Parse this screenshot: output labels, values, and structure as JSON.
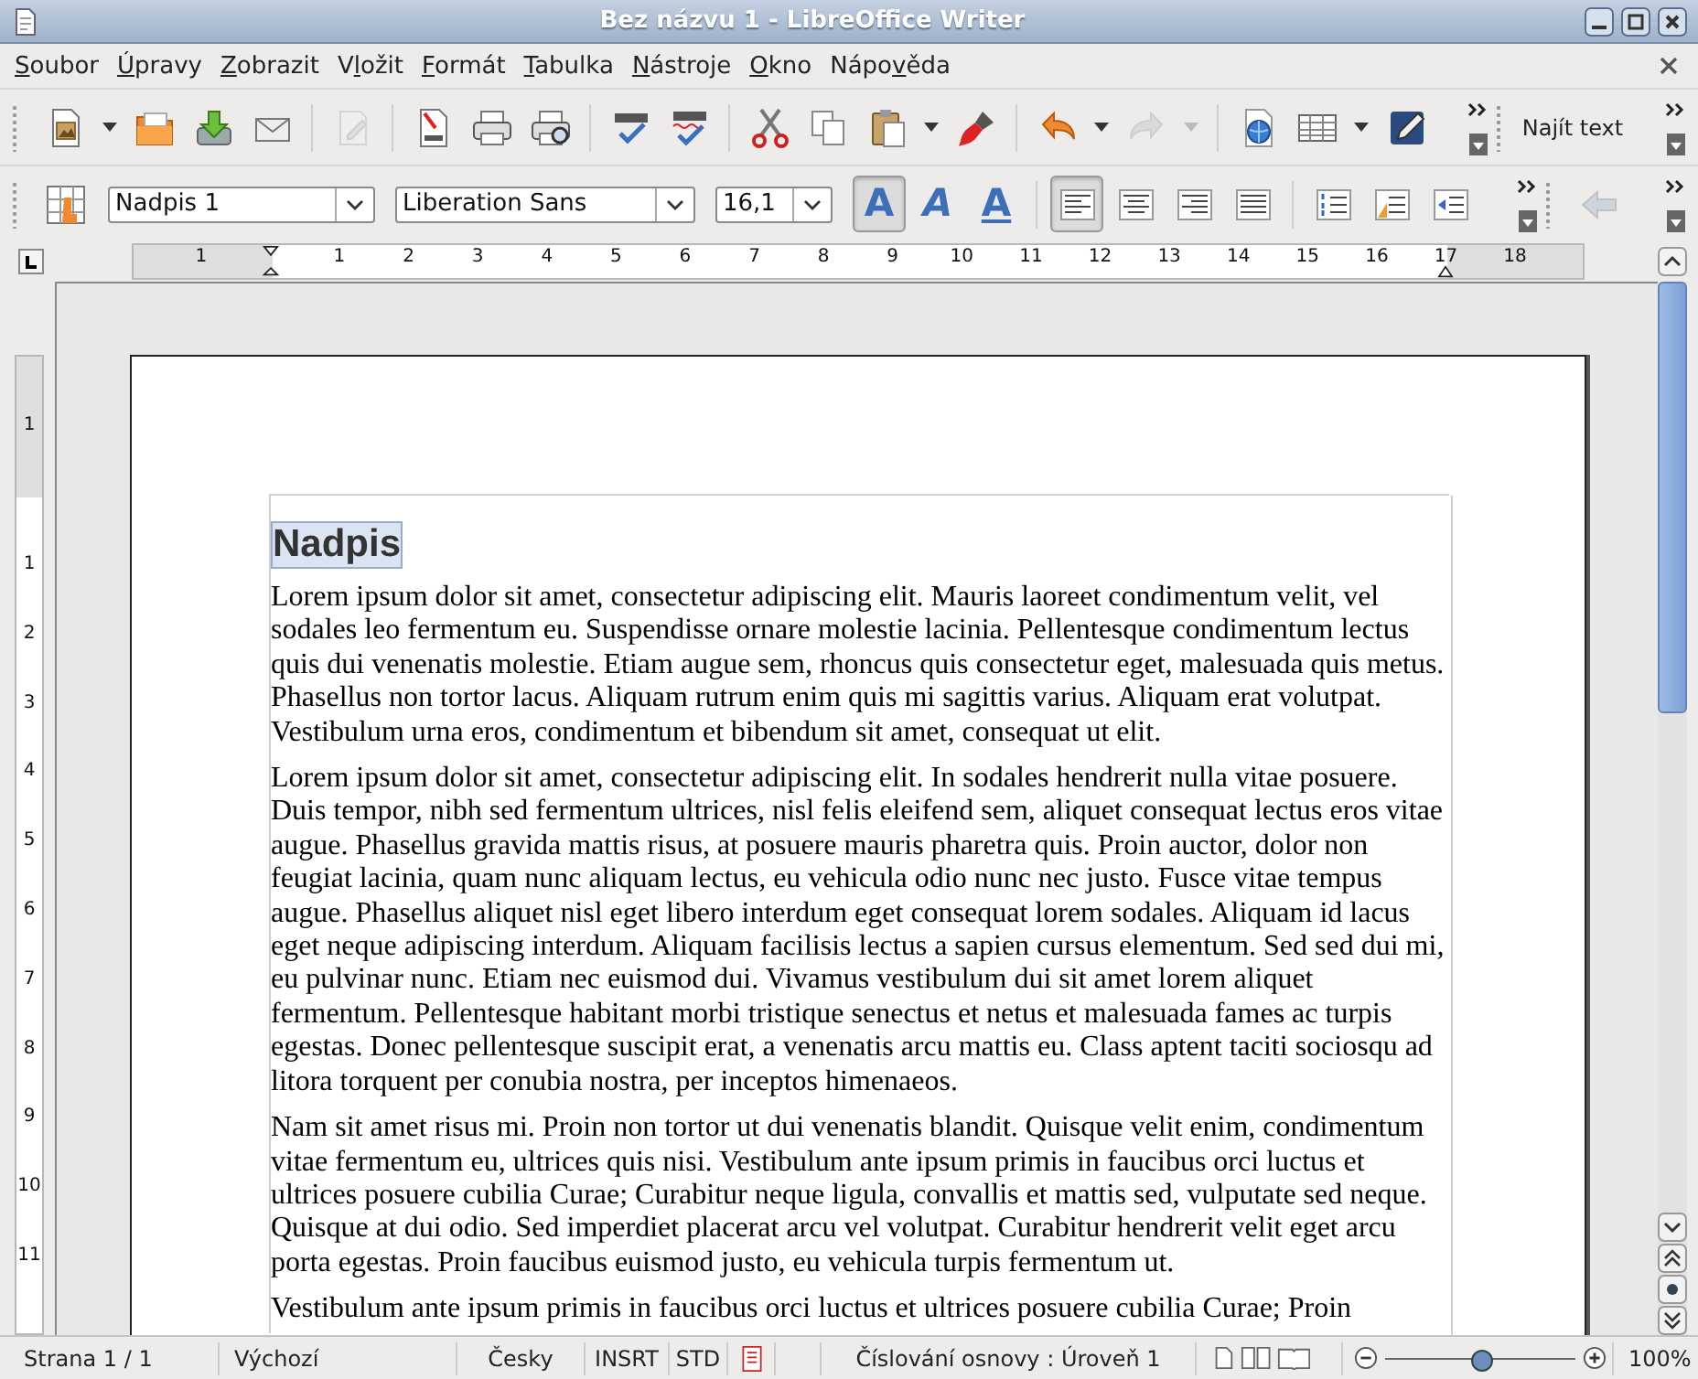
{
  "window": {
    "title": "Bez názvu 1 - LibreOffice Writer"
  },
  "menu": [
    {
      "label": "Soubor"
    },
    {
      "label": "Úpravy"
    },
    {
      "label": "Zobrazit"
    },
    {
      "label": "Vložit"
    },
    {
      "label": "Formát"
    },
    {
      "label": "Tabulka"
    },
    {
      "label": "Nástroje"
    },
    {
      "label": "Okno"
    },
    {
      "label": "Nápověda"
    }
  ],
  "standard_toolbar": {
    "groups": [
      [
        {
          "kind": "new",
          "dropdown": true,
          "disabled": false
        },
        {
          "kind": "open",
          "dropdown": false,
          "disabled": false
        },
        {
          "kind": "save",
          "dropdown": false,
          "disabled": false
        },
        {
          "kind": "mail",
          "dropdown": false,
          "disabled": false
        }
      ],
      [
        {
          "kind": "edit",
          "dropdown": false,
          "disabled": true
        }
      ],
      [
        {
          "kind": "pdf",
          "dropdown": false,
          "disabled": false
        },
        {
          "kind": "print",
          "dropdown": false,
          "disabled": false
        },
        {
          "kind": "preview",
          "dropdown": false,
          "disabled": false
        }
      ],
      [
        {
          "kind": "spell",
          "dropdown": false,
          "disabled": false
        },
        {
          "kind": "autospell",
          "dropdown": false,
          "disabled": false
        }
      ],
      [
        {
          "kind": "cut",
          "dropdown": false,
          "disabled": false
        },
        {
          "kind": "copy",
          "dropdown": false,
          "disabled": false
        },
        {
          "kind": "paste",
          "dropdown": true,
          "disabled": false
        },
        {
          "kind": "brush",
          "dropdown": false,
          "disabled": false
        }
      ],
      [
        {
          "kind": "undo",
          "dropdown": true,
          "disabled": false
        },
        {
          "kind": "redo",
          "dropdown": true,
          "disabled": true
        }
      ],
      [
        {
          "kind": "navigator",
          "dropdown": false,
          "disabled": false
        },
        {
          "kind": "table",
          "dropdown": true,
          "disabled": false
        },
        {
          "kind": "draw",
          "dropdown": false,
          "disabled": false
        }
      ]
    ],
    "find_label": "Najít text"
  },
  "formatting_toolbar": {
    "paragraph_style": "Nadpis 1",
    "font_name": "Liberation Sans",
    "font_size": "16,1",
    "char_buttons": [
      {
        "kind": "bold",
        "label": "A",
        "selected": true
      },
      {
        "kind": "italic",
        "label": "A",
        "selected": false
      },
      {
        "kind": "underline",
        "label": "A",
        "selected": false
      }
    ],
    "align_buttons": [
      {
        "kind": "left",
        "selected": true
      },
      {
        "kind": "center",
        "selected": false
      },
      {
        "kind": "right",
        "selected": false
      },
      {
        "kind": "justify",
        "selected": false
      }
    ],
    "list_buttons": [
      {
        "kind": "numbering"
      },
      {
        "kind": "bullets"
      },
      {
        "kind": "outdent"
      }
    ],
    "back_button": {
      "disabled": true
    }
  },
  "horizontal_ruler": {
    "labels": [
      "1",
      "1",
      "2",
      "3",
      "4",
      "5",
      "6",
      "7",
      "8",
      "9",
      "10",
      "11",
      "12",
      "13",
      "14",
      "15",
      "16",
      "17",
      "18"
    ]
  },
  "vertical_ruler": {
    "labels": [
      "1",
      "1",
      "2",
      "3",
      "4",
      "5",
      "6",
      "7",
      "8",
      "9",
      "10",
      "11"
    ]
  },
  "document": {
    "heading": {
      "text": "Nadpis",
      "selected": true
    },
    "paragraphs": [
      "Lorem ipsum dolor sit amet, consectetur adipiscing elit. Mauris laoreet condimentum velit, vel sodales leo fermentum eu. Suspendisse ornare molestie lacinia. Pellentesque condimentum lectus quis dui venenatis molestie. Etiam augue sem, rhoncus quis consectetur eget, malesuada quis metus. Phasellus non tortor lacus. Aliquam rutrum enim quis mi sagittis varius. Aliquam erat volutpat. Vestibulum urna eros, condimentum et bibendum sit amet, consequat ut elit.",
      "Lorem ipsum dolor sit amet, consectetur adipiscing elit. In sodales hendrerit nulla vitae posuere. Duis tempor, nibh sed fermentum ultrices, nisl felis eleifend sem, aliquet consequat lectus eros vitae augue. Phasellus gravida mattis risus, at posuere mauris pharetra quis. Proin auctor, dolor non feugiat lacinia, quam nunc aliquam lectus, eu vehicula odio nunc nec justo. Fusce vitae tempus augue. Phasellus aliquet nisl eget libero interdum eget consequat lorem sodales. Aliquam id lacus eget neque adipiscing interdum. Aliquam facilisis lectus a sapien cursus elementum. Sed sed dui mi, eu pulvinar nunc. Etiam nec euismod dui. Vivamus vestibulum dui sit amet lorem aliquet fermentum. Pellentesque habitant morbi tristique senectus et netus et malesuada fames ac turpis egestas. Donec pellentesque suscipit erat, a venenatis arcu mattis eu. Class aptent taciti sociosqu ad litora torquent per conubia nostra, per inceptos himenaeos.",
      "Nam sit amet risus mi. Proin non tortor ut dui venenatis blandit. Quisque velit enim, condimentum vitae fermentum eu, ultrices quis nisi. Vestibulum ante ipsum primis in faucibus orci luctus et ultrices posuere cubilia Curae; Curabitur neque ligula, convallis et mattis sed, vulputate sed neque. Quisque at dui odio. Sed imperdiet placerat arcu vel volutpat. Curabitur hendrerit velit eget arcu porta egestas. Proin faucibus euismod justo, eu vehicula turpis fermentum ut.",
      "Vestibulum ante ipsum primis in faucibus orci luctus et ultrices posuere cubilia Curae; Proin"
    ]
  },
  "status_bar": {
    "page": "Strana 1 / 1",
    "page_style": "Výchozí",
    "language": "Česky",
    "insert_mode": "INSRT",
    "selection_mode": "STD",
    "outline": "Číslování osnovy : Úroveň 1",
    "zoom": {
      "level": 0.5
    },
    "zoom_text": "100%"
  }
}
